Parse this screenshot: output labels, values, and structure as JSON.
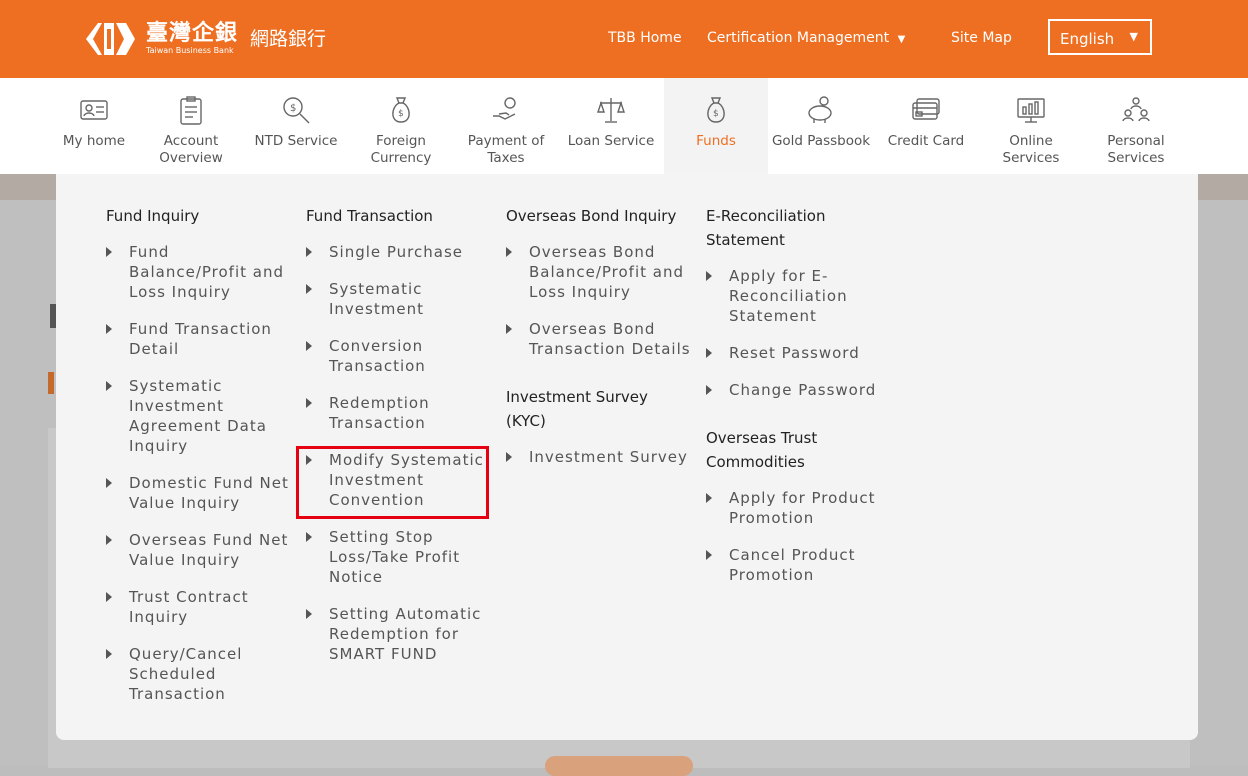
{
  "brand": {
    "name_zh": "臺灣企銀",
    "name_en": "Taiwan Business Bank",
    "sub_zh": "網路銀行",
    "accent_color": "#ee6f22"
  },
  "top_links": [
    {
      "label": "TBB Home"
    },
    {
      "label": "Certification Management",
      "has_dropdown": true
    },
    {
      "label": "Site Map"
    }
  ],
  "language": {
    "label": "English"
  },
  "nav": [
    {
      "label": "My home",
      "icon": "person-card-icon"
    },
    {
      "label": "Account Overview",
      "icon": "clipboard-icon"
    },
    {
      "label": "NTD Service",
      "icon": "coin-search-icon"
    },
    {
      "label": "Foreign Currency",
      "icon": "money-bag-icon"
    },
    {
      "label": "Payment of Taxes",
      "icon": "hand-coin-icon"
    },
    {
      "label": "Loan Service",
      "icon": "scale-icon"
    },
    {
      "label": "Funds",
      "icon": "fund-bag-icon",
      "active": true
    },
    {
      "label": "Gold Passbook",
      "icon": "piggy-bank-icon"
    },
    {
      "label": "Credit Card",
      "icon": "credit-card-icon"
    },
    {
      "label": "Online Services",
      "icon": "monitor-chart-icon"
    },
    {
      "label": "Personal Services",
      "icon": "people-icon"
    }
  ],
  "menu": {
    "fund_inquiry": {
      "title": "Fund Inquiry",
      "items": [
        "Fund Balance/Profit and Loss Inquiry",
        "Fund Transaction Detail",
        "Systematic Investment Agreement Data Inquiry",
        "Domestic Fund Net Value Inquiry",
        "Overseas Fund Net Value Inquiry",
        "Trust Contract Inquiry",
        "Query/Cancel Scheduled Transaction"
      ]
    },
    "fund_transaction": {
      "title": "Fund Transaction",
      "items": [
        "Single Purchase",
        "Systematic Investment",
        "Conversion Transaction",
        "Redemption Transaction",
        "Modify Systematic Investment Convention",
        "Setting Stop Loss/Take Profit Notice",
        "Setting Automatic Redemption for SMART FUND"
      ]
    },
    "overseas_bond": {
      "title": "Overseas Bond Inquiry",
      "items": [
        "Overseas Bond Balance/Profit and Loss Inquiry",
        "Overseas Bond Transaction Details"
      ]
    },
    "kyc": {
      "title": "Investment Survey (KYC)",
      "items": [
        "Investment Survey"
      ]
    },
    "e_reconciliation": {
      "title": "E-Reconciliation Statement",
      "items": [
        "Apply for E-Reconciliation Statement",
        "Reset Password",
        "Change Password"
      ]
    },
    "overseas_trust": {
      "title": "Overseas Trust Commodities",
      "items": [
        "Apply for Product Promotion",
        "Cancel Product Promotion"
      ]
    }
  }
}
